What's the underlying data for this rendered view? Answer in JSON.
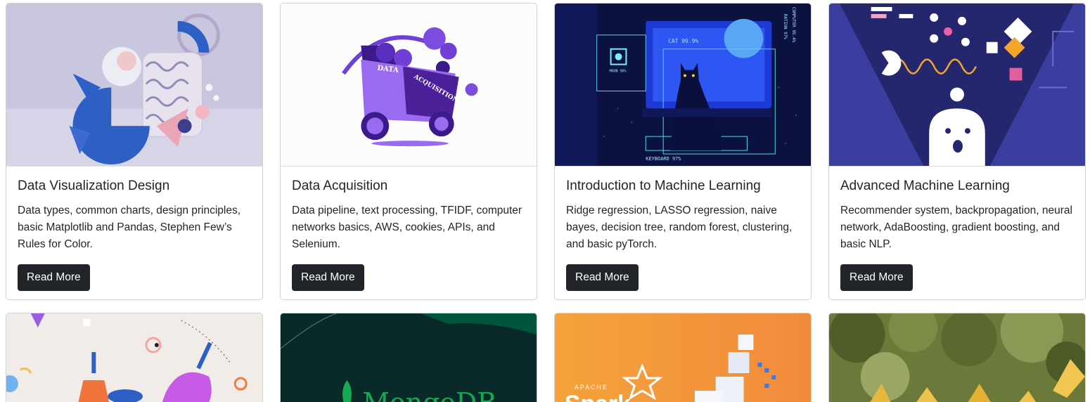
{
  "cards": [
    {
      "title": "Data Visualization Design",
      "text": "Data types, common charts, design principles, basic Matplotlib and Pandas, Stephen Few’s Rules for Color.",
      "button": "Read More"
    },
    {
      "title": "Data Acquisition",
      "text": "Data pipeline, text processing, TFIDF, computer networks basics, AWS, cookies, APIs, and Selenium.",
      "button": "Read More",
      "image_text": [
        "DATA",
        "ACQUISITION"
      ]
    },
    {
      "title": "Introduction to Machine Learning",
      "text": "Ridge regression, LASSO regression, naive bayes, decision tree, random forest, clustering, and basic pyTorch.",
      "button": "Read More",
      "image_text": [
        "CAT 99.9%",
        "MOON 96%",
        "KEYBOARD 97%",
        "COMPUTER 95.4%",
        "RATION 97%"
      ]
    },
    {
      "title": "Advanced Machine Learning",
      "text": "Recommender system, backpropagation, neural network, AdaBoosting, gradient boosting, and basic NLP.",
      "button": "Read More"
    }
  ],
  "row2_images": [
    {
      "name": "cleaning-illustration"
    },
    {
      "name": "mongodb-banner",
      "text": "MongoDB"
    },
    {
      "name": "spark-banner",
      "text": [
        "APACHE",
        "Spark"
      ]
    },
    {
      "name": "paper-birds-photo"
    }
  ],
  "colors": {
    "button_bg": "#212529",
    "button_text": "#ffffff",
    "card_border": "#d6d6d6"
  }
}
